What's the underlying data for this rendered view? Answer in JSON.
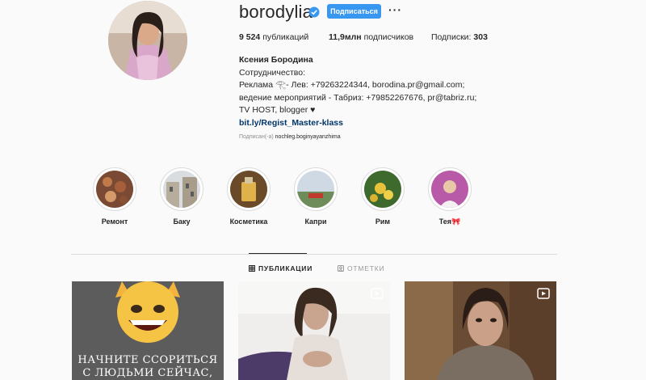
{
  "profile": {
    "username": "borodylia",
    "follow_label": "Подписаться",
    "more_label": "···",
    "stats": {
      "posts_value": "9 524",
      "posts_label": "публикаций",
      "followers_value": "11,9млн",
      "followers_label": "подписчиков",
      "following_label": "Подписки:",
      "following_value": "303"
    },
    "full_name": "Ксения Бородина",
    "bio_lines": [
      "Сотрудничество:",
      "Реклама 𓂀- Лев: +79263224344, borodina.pr@gmail.com;",
      "ведение мероприятий - Табриз: +79852267676, pr@tabriz.ru;",
      "TV HOST, blogger ♥"
    ],
    "link": "bit.ly/Regist_Master-klass",
    "followed_by_label": "Подписан(-а)",
    "followed_by_user": "nochleg.boginyayanzhima"
  },
  "highlights": [
    {
      "label": "Ремонт",
      "icon": "repair-highlight"
    },
    {
      "label": "Баку",
      "icon": "baku-highlight"
    },
    {
      "label": "Косметика",
      "icon": "cosmetics-highlight"
    },
    {
      "label": "Капри",
      "icon": "capri-highlight"
    },
    {
      "label": "Рим",
      "icon": "rome-highlight"
    },
    {
      "label": "Тея🎀",
      "icon": "teya-highlight"
    }
  ],
  "tabs": [
    {
      "label": "ПУБЛИКАЦИИ",
      "icon": "grid-icon",
      "active": true
    },
    {
      "label": "ОТМЕТКИ",
      "icon": "tagged-icon",
      "active": false
    }
  ],
  "posts": [
    {
      "caption": "НАЧНИТЕ ССОРИТЬСЯ С ЛЮДЬМИ СЕЙЧАС, ЧТОБЫ",
      "type": "image"
    },
    {
      "caption": "",
      "type": "video"
    },
    {
      "caption": "",
      "type": "video"
    }
  ],
  "colors": {
    "accent": "#3897f0",
    "link": "#003569",
    "muted": "#8e8e8e",
    "background": "#fafafa"
  }
}
